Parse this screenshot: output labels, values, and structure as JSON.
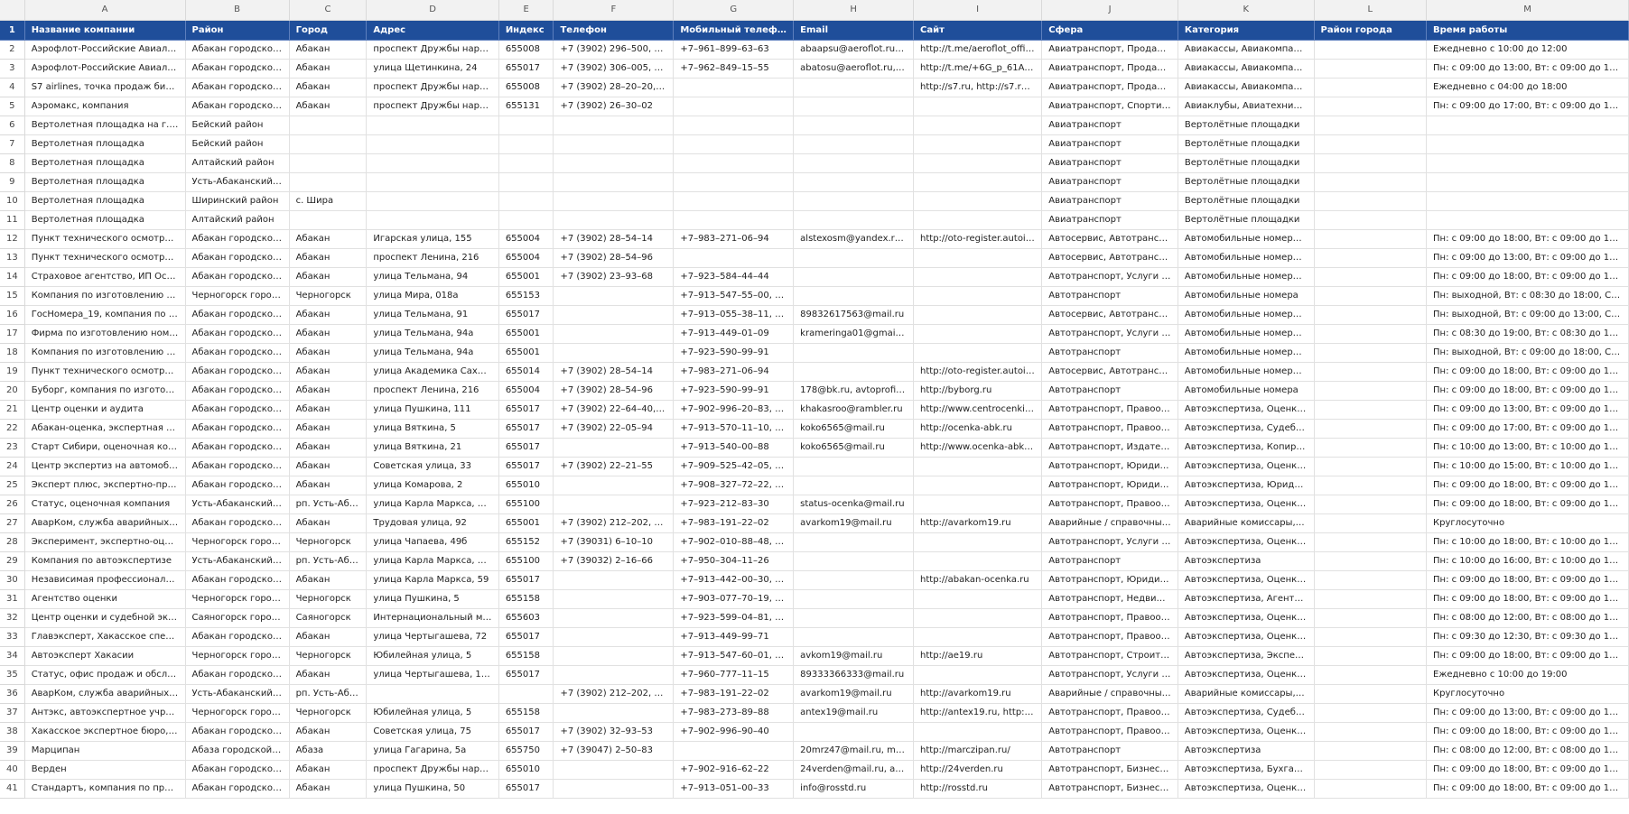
{
  "column_letters": [
    "A",
    "B",
    "C",
    "D",
    "E",
    "F",
    "G",
    "H",
    "I",
    "J",
    "K",
    "L",
    "M"
  ],
  "header_row_number": "1",
  "headers": [
    "Название компании",
    "Район",
    "Город",
    "Адрес",
    "Индекс",
    "Телефон",
    "Мобильный телефон",
    "Email",
    "Сайт",
    "Сфера",
    "Категория",
    "Район города",
    "Время работы"
  ],
  "rows": [
    {
      "n": "2",
      "c": [
        "Аэрофлот-Российские Авиалинии, пр...",
        "Абакан городской округ",
        "Абакан",
        "проспект Дружбы народов, 59",
        "655008",
        "+7 (3902) 296–500, 8–8...",
        "+7–961–899–63–63",
        "abaapsu@aeroflot.ru, c...",
        "http://t.me/aeroflot_offici...",
        "Авиатранспорт, Продажа ...",
        "Авиакассы, Авиакомпании",
        "",
        "Ежедневно с 10:00 до 12:00"
      ]
    },
    {
      "n": "3",
      "c": [
        "Аэрофлот-Российские Авиалинии, ав...",
        "Абакан городской округ",
        "Абакан",
        "улица Щетинкина, 24",
        "655017",
        "+7 (3902) 306–005, 8–8...",
        "+7–962–849–15–55",
        "abatosu@aeroflot.ru, c...",
        "http://t.me/+6G_p_61Axb...",
        "Авиатранспорт, Продажа ...",
        "Авиакассы, Авиакомпании",
        "",
        "Пн: с 09:00 до 13:00, Вт: с 09:00 до 13:00, С..."
      ]
    },
    {
      "n": "4",
      "c": [
        "S7 airlines, точка продаж билетов",
        "Абакан городской округ",
        "Абакан",
        "проспект Дружбы народов, 59",
        "655008",
        "+7 (3902) 28–20–20, +7...",
        "",
        "",
        "http://s7.ru, http://s7.ru/r...",
        "Авиатранспорт, Продажа ...",
        "Авиакассы, Авиакомпании",
        "",
        "Ежедневно с 04:00 до 18:00"
      ]
    },
    {
      "n": "5",
      "c": [
        "Аэромакс, компания",
        "Абакан городской округ",
        "Абакан",
        "проспект Дружбы народов, 65г",
        "655131",
        "+7 (3902) 26–30–02",
        "",
        "",
        "",
        "Авиатранспорт, Спортивн...",
        "Авиаклубы, Авиатехника / ...",
        "",
        "Пн: с 09:00 до 17:00, Вт: с 09:00 до 17:00, С..."
      ]
    },
    {
      "n": "6",
      "c": [
        "Вертолетная площадка на г. Гладеньк...",
        "Бейский район",
        "",
        "",
        "",
        "",
        "",
        "",
        "",
        "Авиатранспорт",
        "Вертолётные площадки",
        "",
        ""
      ]
    },
    {
      "n": "7",
      "c": [
        "Вертолетная площадка",
        "Бейский район",
        "",
        "",
        "",
        "",
        "",
        "",
        "",
        "Авиатранспорт",
        "Вертолётные площадки",
        "",
        ""
      ]
    },
    {
      "n": "8",
      "c": [
        "Вертолетная площадка",
        "Алтайский район",
        "",
        "",
        "",
        "",
        "",
        "",
        "",
        "Авиатранспорт",
        "Вертолётные площадки",
        "",
        ""
      ]
    },
    {
      "n": "9",
      "c": [
        "Вертолетная площадка",
        "Усть-Абаканский район",
        "",
        "",
        "",
        "",
        "",
        "",
        "",
        "Авиатранспорт",
        "Вертолётные площадки",
        "",
        ""
      ]
    },
    {
      "n": "10",
      "c": [
        "Вертолетная площадка",
        "Ширинский район",
        "с. Шира",
        "",
        "",
        "",
        "",
        "",
        "",
        "Авиатранспорт",
        "Вертолётные площадки",
        "",
        ""
      ]
    },
    {
      "n": "11",
      "c": [
        "Вертолетная площадка",
        "Алтайский район",
        "",
        "",
        "",
        "",
        "",
        "",
        "",
        "Авиатранспорт",
        "Вертолётные площадки",
        "",
        ""
      ]
    },
    {
      "n": "12",
      "c": [
        "Пункт технического осмотра №1",
        "Абакан городской округ",
        "Абакан",
        "Игарская улица, 155",
        "655004",
        "+7 (3902) 28–54–14",
        "+7–983–271–06–94",
        "alstexosm@yandex.ru, a...",
        "http://oto-register.autoins...",
        "Автосервис, Автотранспорт",
        "Автомобильные номера, ...",
        "",
        "Пн: с 09:00 до 18:00, Вт: с 09:00 до 18:00, С..."
      ]
    },
    {
      "n": "13",
      "c": [
        "Пункт технического осмотра №3",
        "Абакан городской округ",
        "Абакан",
        "проспект Ленина, 216",
        "655004",
        "+7 (3902) 28–54–96",
        "",
        "",
        "",
        "Автосервис, Автотранспор...",
        "Автомобильные номера, ...",
        "",
        "Пн: с 09:00 до 13:00, Вт: с 09:00 до 13:00, С..."
      ]
    },
    {
      "n": "14",
      "c": [
        "Страховое агентство, ИП Осин А.А.",
        "Абакан городской округ",
        "Абакан",
        "улица Тельмана, 94",
        "655001",
        "+7 (3902) 23–93–68",
        "+7–923–584–44–44",
        "",
        "",
        "Автотранспорт, Услуги стр...",
        "Автомобильные номера, ...",
        "",
        "Пн: с 09:00 до 18:00, Вт: с 09:00 до 18:00, С..."
      ]
    },
    {
      "n": "15",
      "c": [
        "Компания по изготовлению госноме...",
        "Черногорск городской...",
        "Черногорск",
        "улица Мира, 018а",
        "655153",
        "",
        "+7–913–547–55–00, +7...",
        "",
        "",
        "Автотранспорт",
        "Автомобильные номера",
        "",
        "Пн: выходной, Вт: с 08:30 до 18:00, Ср: с 0..."
      ]
    },
    {
      "n": "16",
      "c": [
        "ГосНомера_19, компания по изготовл...",
        "Абакан городской округ",
        "Абакан",
        "улица Тельмана, 91",
        "655017",
        "",
        "+7–913–055–38–11, +7...",
        "89832617563@mail.ru",
        "",
        "Автосервис, Автотранспор...",
        "Автомобильные номера, ...",
        "",
        "Пн: выходной, Вт: с 09:00 до 13:00, Ср: с 0..."
      ]
    },
    {
      "n": "17",
      "c": [
        "Фирма по изготовлению номерных з...",
        "Абакан городской округ",
        "Абакан",
        "улица Тельмана, 94а",
        "655001",
        "",
        "+7–913–449–01–09",
        "krameringa01@gmail.c...",
        "",
        "Автотранспорт, Услуги стр...",
        "Автомобильные номера, ...",
        "",
        "Пн: с 08:30 до 19:00, Вт: с 08:30 до 19:00, С..."
      ]
    },
    {
      "n": "18",
      "c": [
        "Компания по изготовлению дубликат...",
        "Абакан городской округ",
        "Абакан",
        "улица Тельмана, 94а",
        "655001",
        "",
        "+7–923–590–99–91",
        "",
        "",
        "Автотранспорт",
        "Автомобильные номера, ...",
        "",
        "Пн: выходной, Вт: с 09:00 до 18:00, Ср: с 0..."
      ]
    },
    {
      "n": "19",
      "c": [
        "Пункт технического осмотра №1",
        "Абакан городской округ",
        "Абакан",
        "улица Академика Сахарова, 1а",
        "655014",
        "+7 (3902) 28–54–14",
        "+7–983–271–06–94",
        "",
        "http://oto-register.autoins...",
        "Автосервис, Автотранспор...",
        "Автомобильные номера, ...",
        "",
        "Пн: с 09:00 до 18:00, Вт: с 09:00 до 18:00, С..."
      ]
    },
    {
      "n": "20",
      "c": [
        "Буборг, компания по изготовлению д...",
        "Абакан городской округ",
        "Абакан",
        "проспект Ленина, 216",
        "655004",
        "+7 (3902) 28–54–96",
        "+7–923–590–99–91",
        "178@bk.ru, avtoprofi.av...",
        "http://byborg.ru",
        "Автотранспорт",
        "Автомобильные номера",
        "",
        "Пн: с 09:00 до 18:00, Вт: с 09:00 до 18:00, С..."
      ]
    },
    {
      "n": "21",
      "c": [
        "Центр оценки и аудита",
        "Абакан городской округ",
        "Абакан",
        "улица Пушкина, 111",
        "655017",
        "+7 (3902) 22–64–40, +7...",
        "+7–902–996–20–83, +7...",
        "khakasroo@rambler.ru",
        "http://www.centrocenki19...",
        "Автотранспорт, Правоохр...",
        "Автоэкспертиза, Оценка с...",
        "",
        "Пн: с 09:00 до 13:00, Вт: с 09:00 до 13:00, С..."
      ]
    },
    {
      "n": "22",
      "c": [
        "Абакан-оценка, экспертная компания",
        "Абакан городской округ",
        "Абакан",
        "улица Вяткина, 5",
        "655017",
        "+7 (3902) 22–05–94",
        "+7–913–570–11–10, +7...",
        "koko6565@mail.ru",
        "http://ocenka-abk.ru",
        "Автотранспорт, Правоохр...",
        "Автоэкспертиза, Судебная ...",
        "",
        "Пн: с 09:00 до 17:00, Вт: с 09:00 до 17:00, С..."
      ]
    },
    {
      "n": "23",
      "c": [
        "Старт Сибири, оценочная компания",
        "Абакан городской округ",
        "Абакан",
        "улица Вяткина, 21",
        "655017",
        "",
        "+7–913–540–00–88",
        "koko6565@mail.ru",
        "http://www.ocenka-abk.ru",
        "Автотранспорт, Издательс...",
        "Автоэкспертиза, Копирова...",
        "",
        "Пн: с 10:00 до 13:00, Вт: с 10:00 до 13:00, С..."
      ]
    },
    {
      "n": "24",
      "c": [
        "Центр экспертиз на автомобильном т...",
        "Абакан городской округ",
        "Абакан",
        "Советская улица, 33",
        "655017",
        "+7 (3902) 22–21–55",
        "+7–909–525–42–05, +7...",
        "",
        "",
        "Автотранспорт, Юридичес...",
        "Автоэкспертиза, Оценка с...",
        "",
        "Пн: с 10:00 до 15:00, Вт: с 10:00 до 15:00, С..."
      ]
    },
    {
      "n": "25",
      "c": [
        "Эксперт плюс, экспертно-правовой ц...",
        "Абакан городской округ",
        "Абакан",
        "улица Комарова, 2",
        "655010",
        "",
        "+7–908–327–72–22, +7...",
        "",
        "",
        "Автотранспорт, Юридичес...",
        "Автоэкспертиза, Юридиче...",
        "",
        "Пн: с 09:00 до 18:00, Вт: с 09:00 до 18:00, С..."
      ]
    },
    {
      "n": "26",
      "c": [
        "Статус, оценочная компания",
        "Усть-Абаканский район",
        "рп. Усть-Абакан",
        "улица Карла Маркса, 11а",
        "655100",
        "",
        "+7–923–212–83–30",
        "status-ocenka@mail.ru",
        "",
        "Автотранспорт, Правоохр...",
        "Автоэкспертиза, Оценка с...",
        "",
        "Пн: с 09:00 до 18:00, Вт: с 09:00 до 18:00, С..."
      ]
    },
    {
      "n": "27",
      "c": [
        "АварКом, служба аварийных комисса...",
        "Абакан городской округ",
        "Абакан",
        "Трудовая улица, 92",
        "655001",
        "+7 (3902) 212–202, +7 (...",
        "+7–983–191–22–02",
        "avarkom19@mail.ru",
        "http://avarkom19.ru",
        "Аварийные / справочные ...",
        "Аварийные комиссары, Ав...",
        "",
        "Круглосуточно"
      ]
    },
    {
      "n": "28",
      "c": [
        "Эксперимент, экспертно-оценочная к...",
        "Черногорск городской...",
        "Черногорск",
        "улица Чапаева, 49б",
        "655152",
        "+7 (39031) 6–10–10",
        "+7–902–010–88–48, +7...",
        "",
        "",
        "Автотранспорт, Услуги стр...",
        "Автоэкспертиза, Оценка с...",
        "",
        "Пн: с 10:00 до 18:00, Вт: с 10:00 до 18:00, С..."
      ]
    },
    {
      "n": "29",
      "c": [
        "Компания по автоэкспертизе",
        "Усть-Абаканский район",
        "рп. Усть-Абакан",
        "улица Карла Маркса, 11а",
        "655100",
        "+7 (39032) 2–16–66",
        "+7–950–304–11–26",
        "",
        "",
        "Автотранспорт",
        "Автоэкспертиза",
        "",
        "Пн: с 10:00 до 16:00, Вт: с 10:00 до 16:00, С..."
      ]
    },
    {
      "n": "30",
      "c": [
        "Независимая профессиональная оце...",
        "Абакан городской округ",
        "Абакан",
        "улица Карла Маркса, 59",
        "655017",
        "",
        "+7–913–442–00–30, +7...",
        "",
        "http://abakan-ocenka.ru",
        "Автотранспорт, Юридичес...",
        "Автоэкспертиза, Оценка с...",
        "",
        "Пн: с 09:00 до 18:00, Вт: с 09:00 до 18:00, С..."
      ]
    },
    {
      "n": "31",
      "c": [
        "Агентство оценки",
        "Черногорск городской...",
        "Черногорск",
        "улица Пушкина, 5",
        "655158",
        "",
        "+7–903–077–70–19, +7...",
        "",
        "",
        "Автотранспорт, Недвижим...",
        "Автоэкспертиза, Агентства...",
        "",
        "Пн: с 09:00 до 18:00, Вт: с 09:00 до 18:00, С..."
      ]
    },
    {
      "n": "32",
      "c": [
        "Центр оценки и судебной экспертизы",
        "Саяногорск городской...",
        "Саяногорск",
        "Интернациональный микрора...",
        "655603",
        "",
        "+7–923–599–04–81, +7...",
        "",
        "",
        "Автотранспорт, Правоохр...",
        "Автоэкспертиза, Оценка с...",
        "",
        "Пн: с 08:00 до 12:00, Вт: с 08:00 до 12:00, С..."
      ]
    },
    {
      "n": "33",
      "c": [
        "Главэксперт, Хакасское специализир...",
        "Абакан городской округ",
        "Абакан",
        "улица Чертыгашева, 72",
        "655017",
        "",
        "+7–913–449–99–71",
        "",
        "",
        "Автотранспорт, Правоохр...",
        "Автоэкспертиза, Оценка с...",
        "",
        "Пн: с 09:30 до 12:30, Вт: с 09:30 до 12:30, С..."
      ]
    },
    {
      "n": "34",
      "c": [
        "Автоэксперт Хакасии",
        "Черногорск городской...",
        "Черногорск",
        "Юбилейная улица, 5",
        "655158",
        "",
        "+7–913–547–60–01, +7...",
        "avkom19@mail.ru",
        "http://ae19.ru",
        "Автотранспорт, Строитель...",
        "Автоэкспертиза, Эксперти...",
        "",
        "Пн: с 09:00 до 18:00, Вт: с 09:00 до 18:00, С..."
      ]
    },
    {
      "n": "35",
      "c": [
        "Статус, офис продаж и обслуживания",
        "Абакан городской округ",
        "Абакан",
        "улица Чертыгашева, 146",
        "655017",
        "",
        "+7–960–777–11–15",
        "89333366333@mail.ru",
        "",
        "Автотранспорт, Услуги стр...",
        "Автоэкспертиза, Оценка с...",
        "",
        "Ежедневно с 10:00 до 19:00"
      ]
    },
    {
      "n": "36",
      "c": [
        "АварКом, служба аварийных комисса...",
        "Усть-Абаканский район",
        "рп. Усть-Абакан",
        "",
        "",
        "+7 (3902) 212–202, +7 (...",
        "+7–983–191–22–02",
        "avarkom19@mail.ru",
        "http://avarkom19.ru",
        "Аварийные / справочные ...",
        "Аварийные комиссары, Ав...",
        "",
        "Круглосуточно"
      ]
    },
    {
      "n": "37",
      "c": [
        "Антэкс, автоэкспертное учреждение",
        "Черногорск городской...",
        "Черногорск",
        "Юбилейная улица, 5",
        "655158",
        "",
        "+7–983–273–89–88",
        "antex19@mail.ru",
        "http://antex19.ru, http://...",
        "Автотранспорт, Правоохр...",
        "Автоэкспертиза, Судебная ...",
        "",
        "Пн: с 09:00 до 13:00, Вт: с 09:00 до 13:00, С..."
      ]
    },
    {
      "n": "38",
      "c": [
        "Хакасское экспертное бюро, компания",
        "Абакан городской округ",
        "Абакан",
        "Советская улица, 75",
        "655017",
        "+7 (3902) 32–93–53",
        "+7–902–996–90–40",
        "",
        "",
        "Автотранспорт, Правоохр...",
        "Автоэкспертиза, Оценка с...",
        "",
        "Пн: с 09:00 до 18:00, Вт: с 09:00 до 18:00, С..."
      ]
    },
    {
      "n": "39",
      "c": [
        "Марципан",
        "Абаза городской округ",
        "Абаза",
        "улица Гагарина, 5а",
        "655750",
        "+7 (39047) 2–50–83",
        "",
        "20mrz47@mail.ru, mrz4...",
        "http://marczipan.ru/",
        "Автотранспорт",
        "Автоэкспертиза",
        "",
        "Пн: с 08:00 до 12:00, Вт: с 08:00 до 12:00, С..."
      ]
    },
    {
      "n": "40",
      "c": [
        "Верден",
        "Абакан городской округ",
        "Абакан",
        "проспект Дружбы народов, 2а",
        "655010",
        "",
        "+7–902–916–62–22",
        "24verden@mail.ru, arin...",
        "http://24verden.ru",
        "Автотранспорт, Бизнес-ус...",
        "Автоэкспертиза, Бухгалтер...",
        "",
        "Пн: с 09:00 до 18:00, Вт: с 09:00 до 18:00, С..."
      ]
    },
    {
      "n": "41",
      "c": [
        "Стандартъ, компания по предоставле...",
        "Абакан городской округ",
        "Абакан",
        "улица Пушкина, 50",
        "655017",
        "",
        "+7–913–051–00–33",
        "info@rosstd.ru",
        "http://rosstd.ru",
        "Автотранспорт, Бизнес-ус...",
        "Автоэкспертиза, Оценка с...",
        "",
        "Пн: с 09:00 до 18:00, Вт: с 09:00 до 18:00, С..."
      ]
    }
  ]
}
